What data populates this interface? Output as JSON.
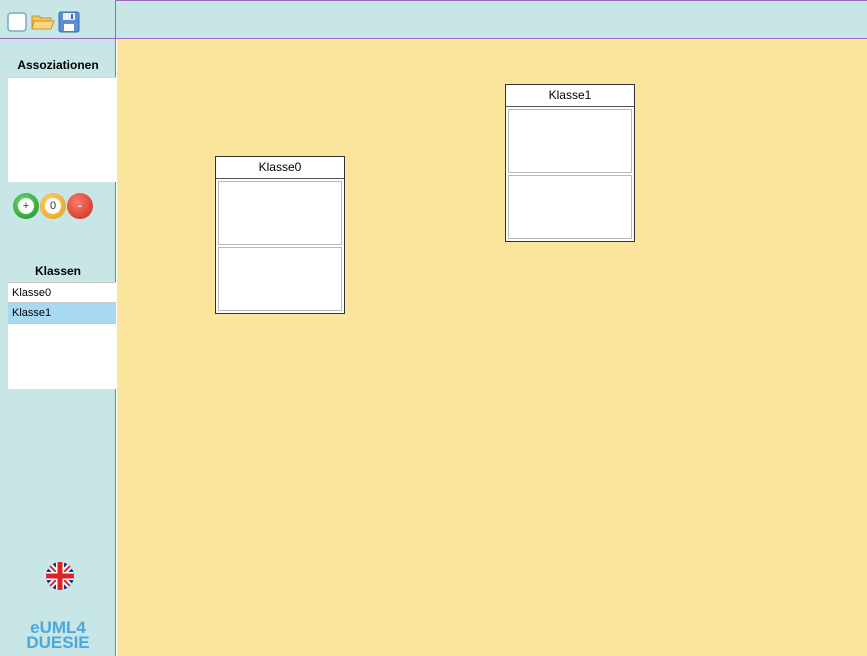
{
  "toolbar": {
    "new_icon": "new-document-icon",
    "open_icon": "folder-open-icon",
    "save_icon": "floppy-disk-icon"
  },
  "sidebar": {
    "associations_title": "Assoziationen",
    "add_label": "+",
    "edit_label": "0",
    "remove_label": "-",
    "classes_title": "Klassen",
    "classes": [
      {
        "label": "Klasse0",
        "selected": false
      },
      {
        "label": "Klasse1",
        "selected": true
      }
    ],
    "language_icon": "uk-flag-icon",
    "brand_line1": "eUML4",
    "brand_line2": "DUESIE"
  },
  "canvas": {
    "classes": [
      {
        "name": "Klasse0"
      },
      {
        "name": "Klasse1"
      }
    ]
  },
  "colors": {
    "sidebar_bg": "#c9e6e6",
    "canvas_bg": "#fbe59c",
    "selected_item": "#a8d9f2",
    "brand": "#4aa8e0",
    "border_accent": "#9b6bc0"
  }
}
